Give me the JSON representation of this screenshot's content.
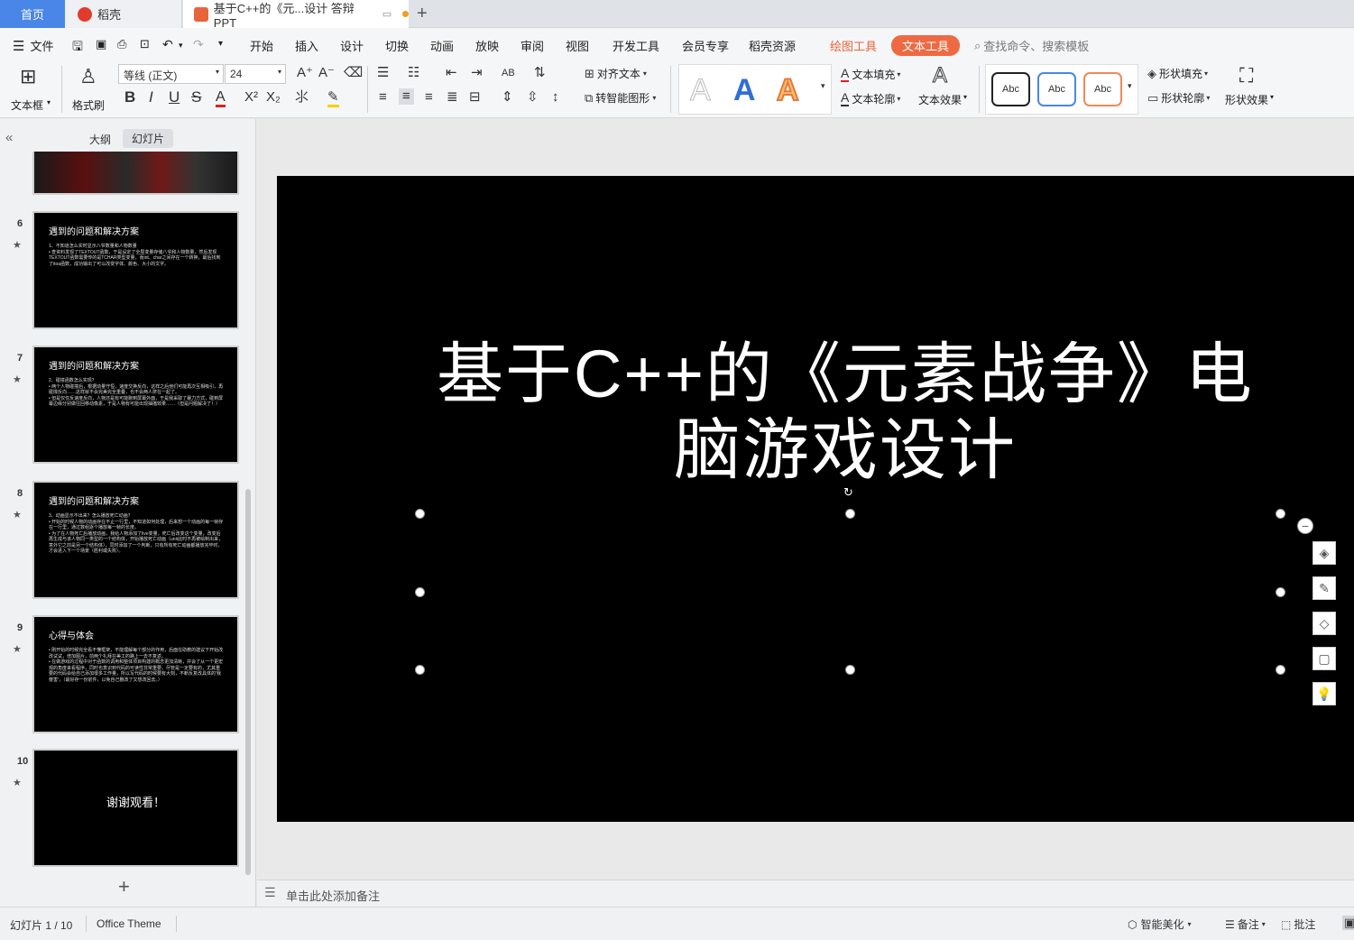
{
  "tabs": {
    "home": "首页",
    "daoke": "稻壳",
    "doc": "基于C++的《元...设计 答辩PPT",
    "new_tab": "+"
  },
  "menu": {
    "file": "文件",
    "items": [
      "开始",
      "插入",
      "设计",
      "切换",
      "动画",
      "放映",
      "审阅",
      "视图",
      "开发工具",
      "会员专享",
      "稻壳资源"
    ],
    "drawing_tools": "绘图工具",
    "text_tools": "文本工具",
    "search_placeholder": "查找命令、搜索模板"
  },
  "ribbon": {
    "textbox": "文本框",
    "format_painter": "格式刷",
    "font_name": "等线 (正文)",
    "font_size": "24",
    "align_text": "对齐文本",
    "smart_shape": "转智能图形",
    "text_fill": "文本填充",
    "text_outline": "文本轮廓",
    "text_effect": "文本效果",
    "abc": "Abc",
    "shape_fill": "形状填充",
    "shape_outline": "形状轮廓",
    "shape_effect": "形状效果",
    "wordart_a": "A"
  },
  "panel": {
    "outline_tab": "大纲",
    "slides_tab": "幻灯片",
    "add_slide": "+"
  },
  "slides": [
    {
      "num": "6",
      "title": "遇到的问题和解决方案",
      "body": "1、不知道怎么实时显示八爷数量和人物数量\n• 查资料发现了TEXTOUT函数，于是设定了全局变量存储八爷和人物数量，然后发现TEXTOUT函数需要传的是TCHAR类型变量，而int、char之间存在一个转换，最后找到了itoa函数，成功输出了可以改变字体、颜色、大小的文字。"
    },
    {
      "num": "7",
      "title": "遇到的问题和解决方案",
      "body": "2、碰撞函数怎么实现？\n• 两个人物碰撞后，根据动量守恒，速度交换反向，这样之后他们可能再次互相吸引，再碰撞反向……这样就不会完美完全重叠，也不会两人挤在一起了。\n• 但是仅仅反速度反向，人物还是有可能跑到屏幕外面，于是我采取了暴力方式，碰到屏幕边缘分别做往回移动像素，于是人物有可能出现抽搐效果……（但是问题解决了！）"
    },
    {
      "num": "8",
      "title": "遇到的问题和解决方案",
      "body": "3、动画显示不出来？怎么播放死亡动画？\n• 开始的时候人物的动画存在不止一行里，不知道如何处理，后来想一个动画的每一帧存在一行里，通过数组逐个播放每一帧的长度。\n• 为了在人物死亡后播放动画，我给人物添加了live变量，死亡后改变这个变量，改变后再生成与该人物同一类型的一个结构体，开始播放死亡动画（unit此时不再被绘制出来，意外它之前是另一个结构体），同时添加了一个判断，只有所有死亡动画都播放完毕时，才会进入下一个场景（胜利或失败）。"
    },
    {
      "num": "9",
      "title": "心得与体会",
      "body": "• 刚开始的时候完全看不懂框架，不能理解每个部分的作用，后面在助教的建议下开始改改试试，增加图片，前两个礼拜在美工的路上一去不复返。\n• 在做游戏的过程中对于函数的调用和整体项目构建的概念更加清晰，并会了从一个更宏观的角度来看程序，同时也意识到代码的可读性非常重要，尽管是一定要有的，尤其重要的代码会给自己添加很多工作量，所以写代码的时候要有大刻，不断反复改具体的'我傻害'，（最好存一份前件，以免自己删改了又想改回去。）"
    },
    {
      "num": "10",
      "title": "谢谢观看！",
      "body": ""
    }
  ],
  "slide_main": {
    "title": "基于C++的《元素战争》电脑游戏设计"
  },
  "notes_placeholder": "单击此处添加备注",
  "status": {
    "slide_count": "幻灯片 1 / 10",
    "theme": "Office Theme",
    "beautify": "智能美化",
    "notes": "备注",
    "comment": "批注"
  }
}
